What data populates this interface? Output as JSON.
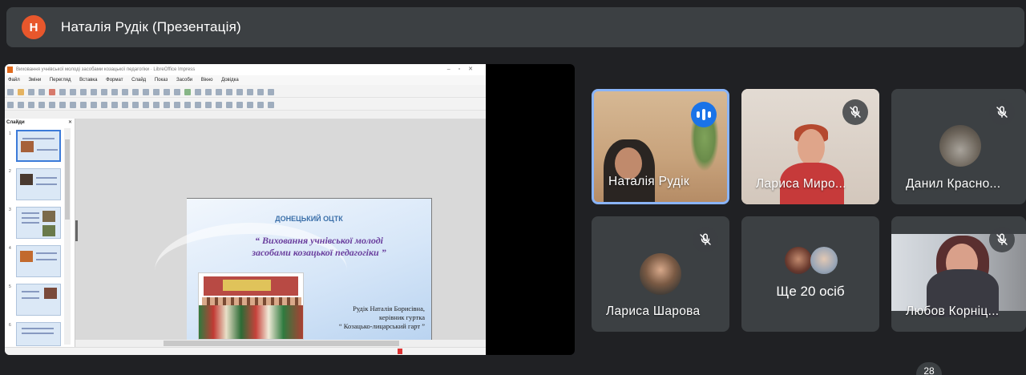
{
  "header": {
    "avatar_letter": "Н",
    "title": "Наталія Рудік (Презентація)"
  },
  "presentation": {
    "window_title": "Виховання учнівської молоді засобами козацької педагогіки · LibreOffice Impress",
    "menu": [
      "Файл",
      "Зміни",
      "Перегляд",
      "Вставка",
      "Формат",
      "Слайд",
      "Показ",
      "Засоби",
      "Вікно",
      "Довідка"
    ],
    "slides_panel_title": "Слайди",
    "slide_numbers": [
      "1",
      "2",
      "3",
      "4",
      "5",
      "6"
    ],
    "slide": {
      "org": "ДОНЕЦЬКИЙ ОЦТК",
      "title_line1": "“ Виховання учнівської молоді",
      "title_line2": "засобами козацької педагогіки ”",
      "author_line1": "Рудік Наталія Борисівна,",
      "author_line2": "керівник гуртка",
      "author_line3": "“ Козацько-лицарський гарт ”"
    }
  },
  "participants": [
    {
      "name": "Наталія Рудік",
      "state": "speaking"
    },
    {
      "name": "Лариса Миро...",
      "state": "muted"
    },
    {
      "name": "Данил Красно...",
      "state": "muted"
    },
    {
      "name": "Лариса Шарова",
      "state": "muted"
    },
    {
      "name": "Ще 20 осіб",
      "state": "group"
    },
    {
      "name": "Любов Корніц...",
      "state": "muted"
    }
  ],
  "participant_count": "28",
  "colors": {
    "background": "#202124",
    "tile": "#3c4043",
    "accent": "#1a73e8",
    "avatar": "#e8572c"
  },
  "icons": [
    "mic-off-icon",
    "speaking-indicator-icon"
  ]
}
